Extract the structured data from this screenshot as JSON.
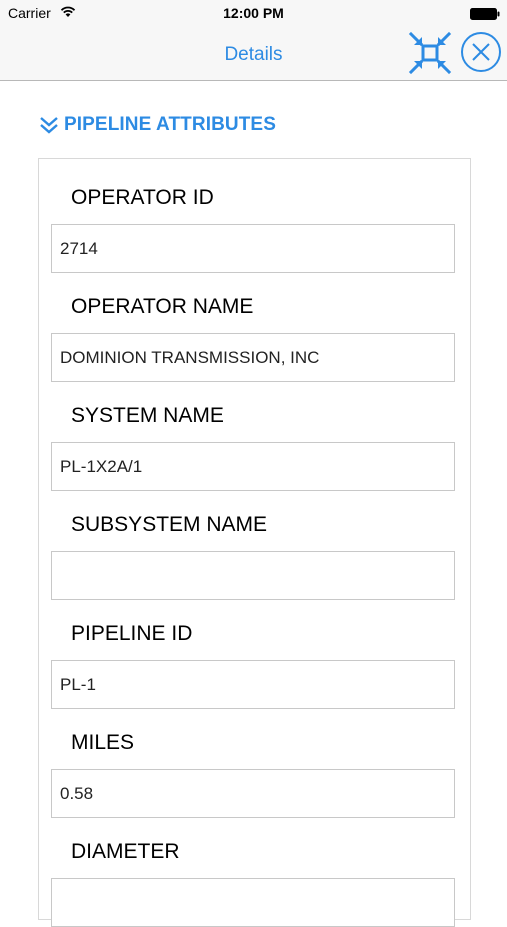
{
  "status_bar": {
    "carrier": "Carrier",
    "time": "12:00 PM"
  },
  "nav": {
    "title": "Details"
  },
  "section": {
    "title": "PIPELINE ATTRIBUTES"
  },
  "fields": [
    {
      "label": "OPERATOR ID",
      "value": "2714"
    },
    {
      "label": "OPERATOR NAME",
      "value": "DOMINION TRANSMISSION, INC"
    },
    {
      "label": "SYSTEM NAME",
      "value": "PL-1X2A/1"
    },
    {
      "label": "SUBSYSTEM NAME",
      "value": ""
    },
    {
      "label": "PIPELINE ID",
      "value": "PL-1"
    },
    {
      "label": "MILES",
      "value": "0.58"
    },
    {
      "label": "DIAMETER",
      "value": ""
    }
  ],
  "colors": {
    "accent": "#2d8be3",
    "bar_background": "#f7f7f7"
  },
  "icons": {
    "collapse": "collapse-arrows-icon",
    "close": "close-circle-icon",
    "section": "double-chevron-down-icon"
  }
}
